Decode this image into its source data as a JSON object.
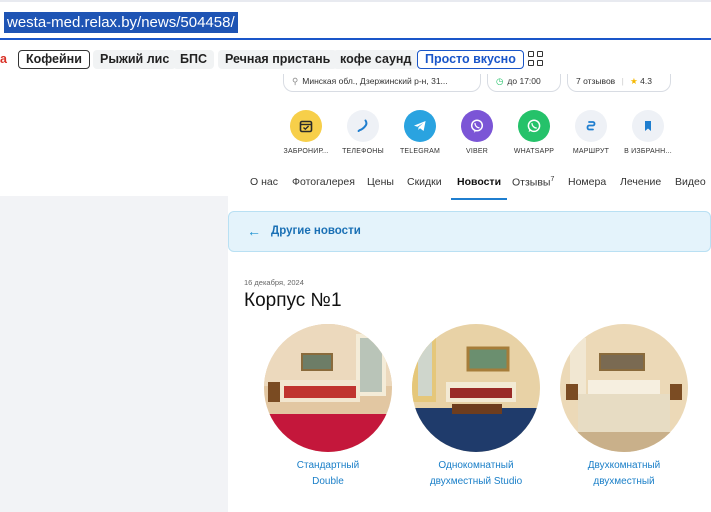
{
  "browser": {
    "url": "westa-med.relax.by/news/504458/"
  },
  "bookmarks": [
    {
      "label": "а",
      "style": "red"
    },
    {
      "label": "Кофейни",
      "style": "outline"
    },
    {
      "label": "Рыжий лис",
      "style": "plain"
    },
    {
      "label": "БПС",
      "style": "plain"
    },
    {
      "label": "Речная пристань",
      "style": "plain"
    },
    {
      "label": "кофе саунд",
      "style": "plain"
    },
    {
      "label": "Просто вкусно",
      "style": "blue"
    }
  ],
  "info_chips": {
    "address": "Минская обл., Дзержинский р-н, 31...",
    "hours": "до 17:00",
    "reviews": "7 отзывов",
    "rating": "4.3"
  },
  "actions": [
    {
      "label": "ЗАБРОНИР...",
      "icon": "calendar-icon",
      "bg": "#f7cf4a",
      "fg": "#2a2a2a"
    },
    {
      "label": "ТЕЛЕФОНЫ",
      "icon": "phone-icon",
      "bg": "#eef1f6",
      "fg": "#1f7ecf"
    },
    {
      "label": "TELEGRAM",
      "icon": "telegram-icon",
      "bg": "#2aa3e0",
      "fg": "#ffffff"
    },
    {
      "label": "VIBER",
      "icon": "viber-icon",
      "bg": "#7b55d6",
      "fg": "#ffffff"
    },
    {
      "label": "WHATSAPP",
      "icon": "whatsapp-icon",
      "bg": "#25c26a",
      "fg": "#ffffff"
    },
    {
      "label": "МАРШРУТ",
      "icon": "route-icon",
      "bg": "#eef1f6",
      "fg": "#1f7ecf"
    },
    {
      "label": "В ИЗБРАНН...",
      "icon": "bookmark-icon",
      "bg": "#eef1f6",
      "fg": "#1f7ecf"
    }
  ],
  "tabs": [
    {
      "label": "О нас"
    },
    {
      "label": "Фотогалерея"
    },
    {
      "label": "Цены"
    },
    {
      "label": "Скидки"
    },
    {
      "label": "Новости",
      "active": true
    },
    {
      "label": "Отзывы",
      "sup": "7"
    },
    {
      "label": "Номера"
    },
    {
      "label": "Лечение"
    },
    {
      "label": "Видео"
    }
  ],
  "back_link": "Другие новости",
  "news": {
    "date": "16 декабря, 2024",
    "title": "Корпус №1",
    "rooms": [
      {
        "line1": "Стандартный",
        "line2": "Double",
        "variant": "red"
      },
      {
        "line1": "Однокомнатный",
        "line2": "двухместный Studio",
        "variant": "blue"
      },
      {
        "line1": "Двухкомнатный",
        "line2": "двухместный",
        "variant": "cream"
      }
    ]
  },
  "colors": {
    "accent": "#1f7ecf",
    "link": "#1a7fc8",
    "url_highlight": "#1e54b4",
    "back_bar_bg": "#e4f3fb"
  }
}
